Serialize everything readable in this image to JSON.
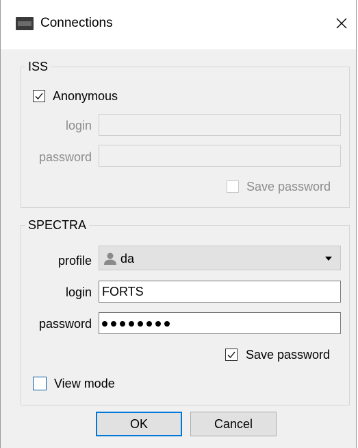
{
  "window": {
    "title": "Connections",
    "app_icon": "moex-app-icon",
    "close_icon": "close-icon"
  },
  "iss": {
    "group_label": "ISS",
    "anonymous_label": "Anonymous",
    "anonymous_checked": true,
    "login_label": "login",
    "login_value": "",
    "password_label": "password",
    "password_value": "",
    "save_password_label": "Save password",
    "save_password_checked": false
  },
  "spectra": {
    "group_label": "SPECTRA",
    "profile_label": "profile",
    "profile_value": "da",
    "profile_icon": "user-icon",
    "login_label": "login",
    "login_value": "FORTS",
    "password_label": "password",
    "password_mask_length": 8,
    "save_password_label": "Save password",
    "save_password_checked": true,
    "view_mode_label": "View mode",
    "view_mode_checked": false
  },
  "buttons": {
    "ok_label": "OK",
    "cancel_label": "Cancel"
  },
  "colors": {
    "accent": "#0078d7",
    "dialog_bg": "#f0f0f0",
    "disabled_text": "#8c8c8c"
  }
}
